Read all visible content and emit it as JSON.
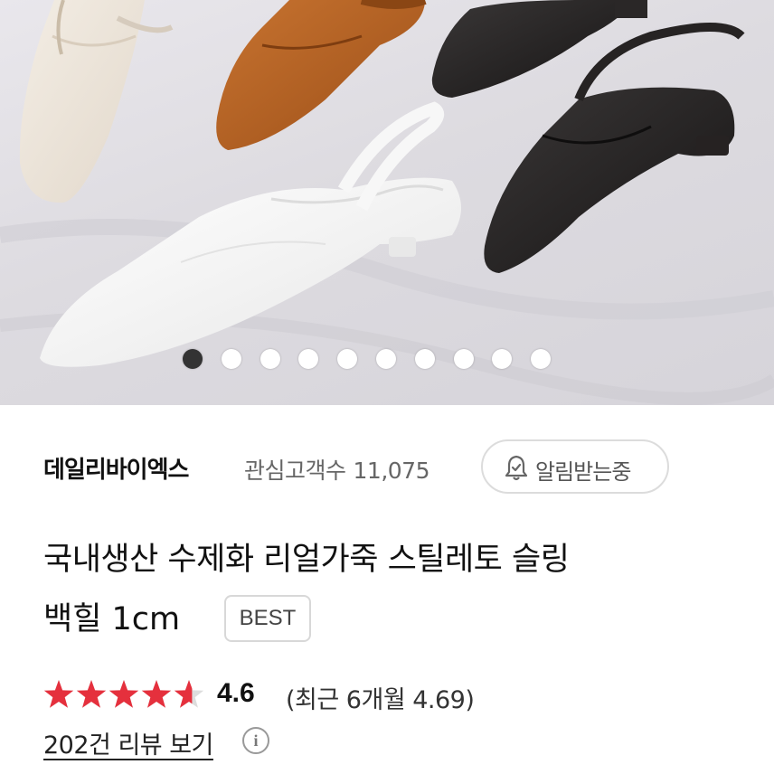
{
  "carousel": {
    "image_alt": "slingback flat shoes in white, cream, brown and black",
    "dot_count": 10,
    "active_index": 0
  },
  "seller": {
    "name": "데일리바이엑스",
    "interest_label": "관심고객수",
    "interest_count": "11,075",
    "alarm_label": "알림받는중"
  },
  "product": {
    "title_line1": "국내생산 수제화 리얼가죽 스틸레토 슬링",
    "title_line2": "백힐 1cm",
    "badge": "BEST"
  },
  "rating": {
    "score": "4.6",
    "stars_value": 4.6,
    "stars_max": 5,
    "recent": "(최근 6개월 4.69)",
    "star_color": "#e5303d"
  },
  "reviews": {
    "link_label": "202건 리뷰 보기",
    "info_glyph": "i"
  },
  "icons": [
    "bell-icon",
    "star-icon",
    "info-icon"
  ]
}
